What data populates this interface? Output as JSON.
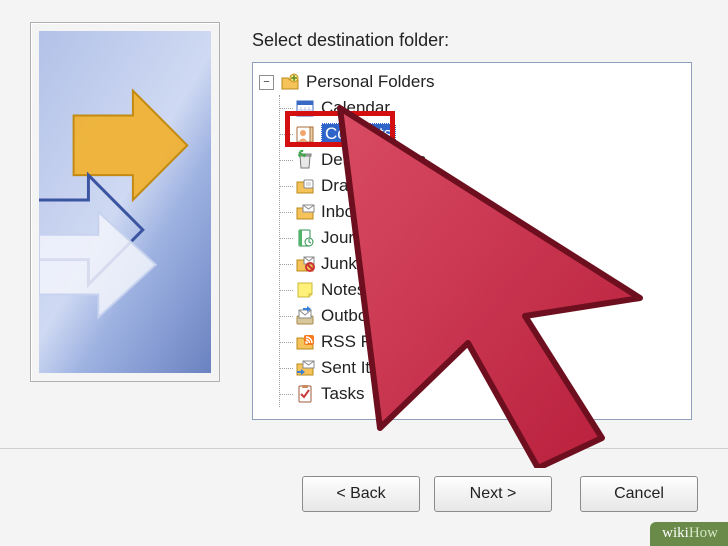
{
  "dialog": {
    "select_label": "Select destination folder:"
  },
  "tree": {
    "root_label": "Personal Folders",
    "items": [
      {
        "label": "Calendar"
      },
      {
        "label": "Contacts"
      },
      {
        "label": "Deleted Items"
      },
      {
        "label": "Drafts"
      },
      {
        "label": "Inbox"
      },
      {
        "label": "Journal"
      },
      {
        "label": "Junk E-mail"
      },
      {
        "label": "Notes"
      },
      {
        "label": "Outbox"
      },
      {
        "label": "RSS Feeds"
      },
      {
        "label": "Sent Items"
      },
      {
        "label": "Tasks"
      }
    ],
    "selected_index": 1
  },
  "buttons": {
    "back": "< Back",
    "next": "Next >",
    "cancel": "Cancel"
  },
  "watermark": {
    "text1": "wiki",
    "text2": "How"
  }
}
